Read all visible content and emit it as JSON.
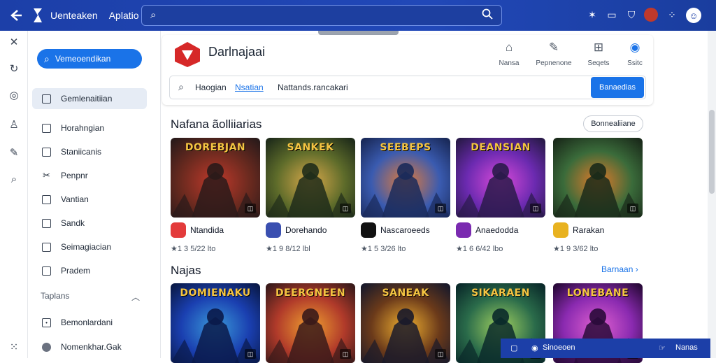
{
  "topbar": {
    "brand": "Uenteaken",
    "brand2": "Aplatio",
    "icons": [
      "back-arrow-icon",
      "app-logo-icon",
      "search-icon",
      "star-icon",
      "window-icon",
      "shield-icon",
      "avatar-icon",
      "grid-icon",
      "profile-icon"
    ]
  },
  "rail": {
    "icons": [
      "close-icon",
      "refresh-icon",
      "compass-icon",
      "person-icon",
      "edit-icon",
      "search-icon",
      "apps-grid-icon"
    ]
  },
  "sidebar": {
    "cta_label": "Vemeoendikan",
    "items": [
      {
        "label": "Gemlenaitiian",
        "active": true
      },
      {
        "label": "Horahngian"
      },
      {
        "label": "Staniicanis"
      },
      {
        "label": "Penpnr"
      },
      {
        "label": "Vantian"
      },
      {
        "label": "Sandk"
      },
      {
        "label": "Seimagiacian"
      },
      {
        "label": "Pradem"
      }
    ],
    "section_label": "Taplans",
    "section_items": [
      {
        "label": "Bemonlardani"
      },
      {
        "label": "Nomenkhar.Gak"
      }
    ]
  },
  "store": {
    "name": "Darlnajaai",
    "icons": [
      {
        "label": "Nansa"
      },
      {
        "label": "Pepnenone"
      },
      {
        "label": "Seqets"
      },
      {
        "label": "Ssitc"
      }
    ],
    "tabs": [
      "Haogian",
      "Nsatian",
      "Nattands.rancakari"
    ],
    "active_tab": 1,
    "button_label": "Banaedias"
  },
  "section1": {
    "title": "Nafana ãolliiarias",
    "action": "Bonnealiiane",
    "games": [
      {
        "art_title": "DOREBJAN",
        "name": "Ntandida",
        "rating": "1 3 5/22 lto",
        "icon_color": "#e33b3b",
        "colors": [
          "#2a1a1a",
          "#6b2a1f",
          "#c0392b"
        ]
      },
      {
        "art_title": "SANKEK",
        "name": "Dorehando",
        "rating": "1 9 8/12 lbl",
        "icon_color": "#3a4fb0",
        "colors": [
          "#1f2c1a",
          "#5d6b2a",
          "#d8a84a"
        ]
      },
      {
        "art_title": "SEEBEPS",
        "name": "Nascaroeeds",
        "rating": "1 5 3/26 lto",
        "icon_color": "#111111",
        "colors": [
          "#1a2a5a",
          "#3a5bb0",
          "#e27a3a"
        ]
      },
      {
        "art_title": "DEANSIAN",
        "name": "Anaedodda",
        "rating": "1 6 6/42 lbo",
        "icon_color": "#7a2ab0",
        "colors": [
          "#2a1a4a",
          "#6b2ab0",
          "#d94ad9"
        ]
      },
      {
        "art_title": "",
        "name": "Rarakan",
        "rating": "1 9 3/62 lto",
        "icon_color": "#e8b220",
        "colors": [
          "#1a2a1a",
          "#3a6b3a",
          "#e27a2a"
        ]
      }
    ]
  },
  "section2": {
    "title": "Najas",
    "action": "Barnaan",
    "games": [
      {
        "art_title": "DOMIENAKU",
        "colors": [
          "#0a1a4a",
          "#1a3fb0",
          "#3a9ad9"
        ]
      },
      {
        "art_title": "DEERGNEEN",
        "colors": [
          "#3a1a1a",
          "#b03a2a",
          "#f0a030"
        ]
      },
      {
        "art_title": "SANEAK",
        "colors": [
          "#1a1a2a",
          "#6b3a1a",
          "#f0b030"
        ]
      },
      {
        "art_title": "SIKARAEN",
        "colors": [
          "#0a2a2a",
          "#2a6b4a",
          "#a0d060"
        ]
      },
      {
        "art_title": "LONEBANE",
        "colors": [
          "#2a0a3a",
          "#8a2ab0",
          "#e060d0"
        ]
      }
    ]
  },
  "bottombar": {
    "label1": "Sinoeoen",
    "label2": "Nanas"
  }
}
